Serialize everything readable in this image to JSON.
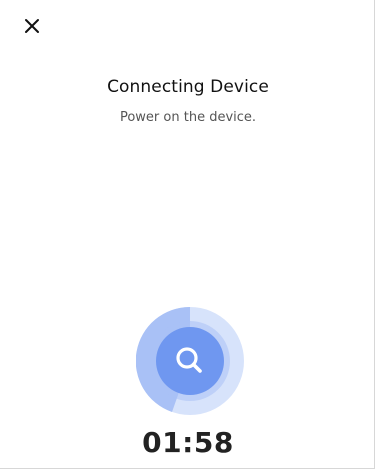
{
  "header": {
    "close_icon": "close-icon"
  },
  "main": {
    "title": "Connecting Device",
    "subtitle": "Power on the device.",
    "scanner_icon": "search-icon",
    "countdown": "01:58"
  },
  "colors": {
    "outer_ring": "#d7e3fb",
    "mid_ring": "#a9c1f6",
    "inner_circle": "#6f97f0",
    "icon": "#ffffff",
    "text_primary": "#111111",
    "text_secondary": "#555555"
  }
}
